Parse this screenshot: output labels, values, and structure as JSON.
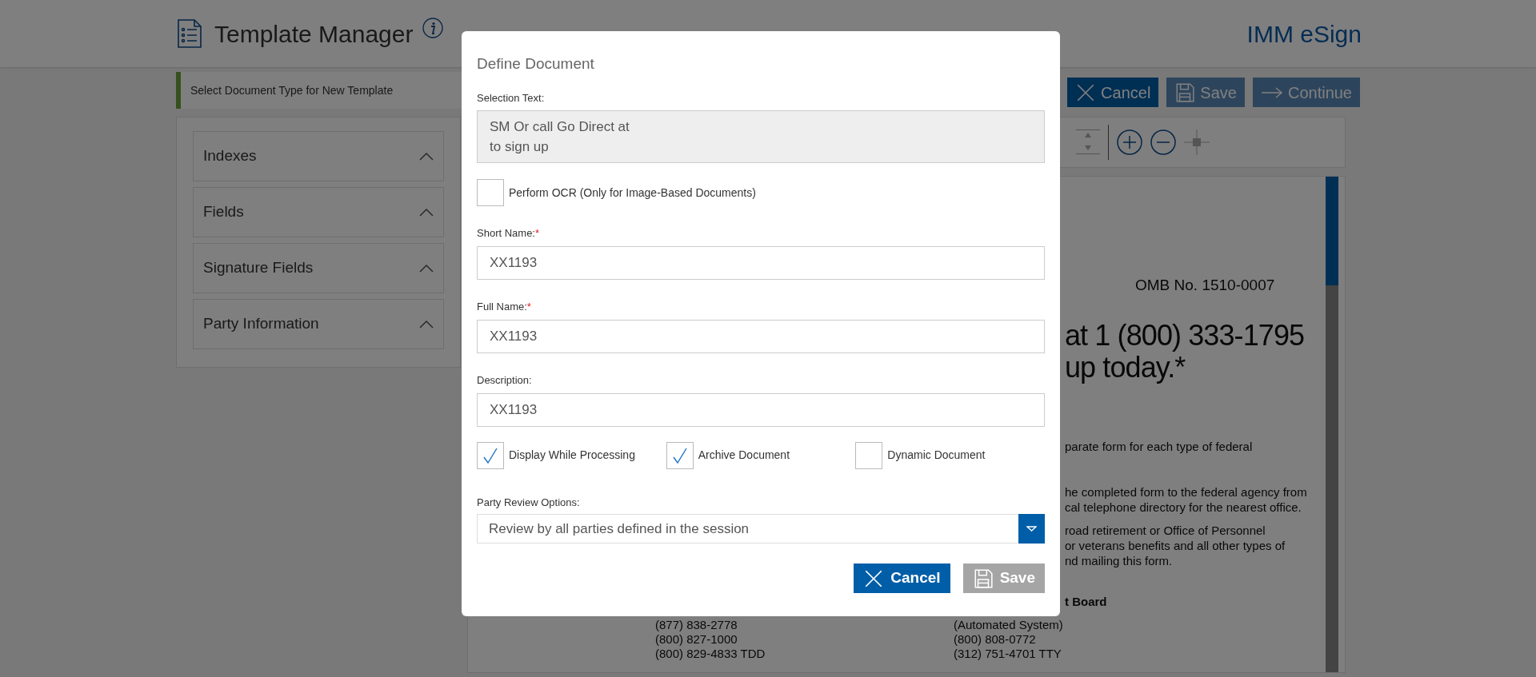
{
  "header": {
    "title": "Template Manager",
    "brand": "IMM eSign"
  },
  "instruction": "Select Document Type for New Template",
  "toolbar_buttons": [
    {
      "label": "Cancel",
      "kind": "cancel"
    },
    {
      "label": "Save",
      "kind": "save"
    },
    {
      "label": "Continue",
      "kind": "continue"
    }
  ],
  "sidebar": {
    "sections": [
      {
        "label": "Indexes"
      },
      {
        "label": "Fields"
      },
      {
        "label": "Signature Fields"
      },
      {
        "label": "Party Information"
      }
    ]
  },
  "document": {
    "lines": [
      {
        "kind": "omb",
        "text": "OMB No. 1510-0007"
      },
      {
        "kind": "headline",
        "text": "at 1 (800) 333-1795"
      },
      {
        "kind": "headline",
        "text": "up today.*"
      },
      {
        "kind": "body",
        "text": "parate form for each type of federal"
      },
      {
        "kind": "body",
        "text": "he completed form to the federal agency from"
      },
      {
        "kind": "body",
        "text": "cal telephone directory for the nearest office."
      },
      {
        "kind": "body",
        "text": "road retirement or Office of Personnel"
      },
      {
        "kind": "body",
        "text": "or veterans benefits and all other types of"
      },
      {
        "kind": "body",
        "text": "nd mailing this form."
      },
      {
        "kind": "bold",
        "text": "t Board"
      }
    ],
    "phones_left": [
      "(877) 838-2778",
      "(800) 827-1000",
      "(800) 829-4833 TDD"
    ],
    "phones_right": [
      "(Automated System)",
      "(800) 808-0772",
      "(312) 751-4701 TTY"
    ]
  },
  "dialog": {
    "title": "Define Document",
    "required_mark": "*",
    "selection_label": "Selection Text:",
    "selection_text": [
      "SM Or call Go Direct at",
      "to sign up"
    ],
    "ocr": {
      "label": "Perform OCR (Only for Image-Based Documents)",
      "checked": false
    },
    "fields": [
      {
        "label": "Short Name:",
        "required": true,
        "value": "XX1193"
      },
      {
        "label": "Full Name:",
        "required": true,
        "value": "XX1193"
      },
      {
        "label": "Description:",
        "required": false,
        "value": "XX1193"
      }
    ],
    "options": [
      {
        "label": "Display While Processing",
        "checked": true
      },
      {
        "label": "Archive Document",
        "checked": true
      },
      {
        "label": "Dynamic Document",
        "checked": false
      }
    ],
    "review_label": "Party Review Options:",
    "review_value": "Review by all parties defined in the session",
    "buttons": [
      {
        "label": "Cancel",
        "kind": "cancel",
        "disabled": false
      },
      {
        "label": "Save",
        "kind": "save",
        "disabled": true
      }
    ]
  }
}
